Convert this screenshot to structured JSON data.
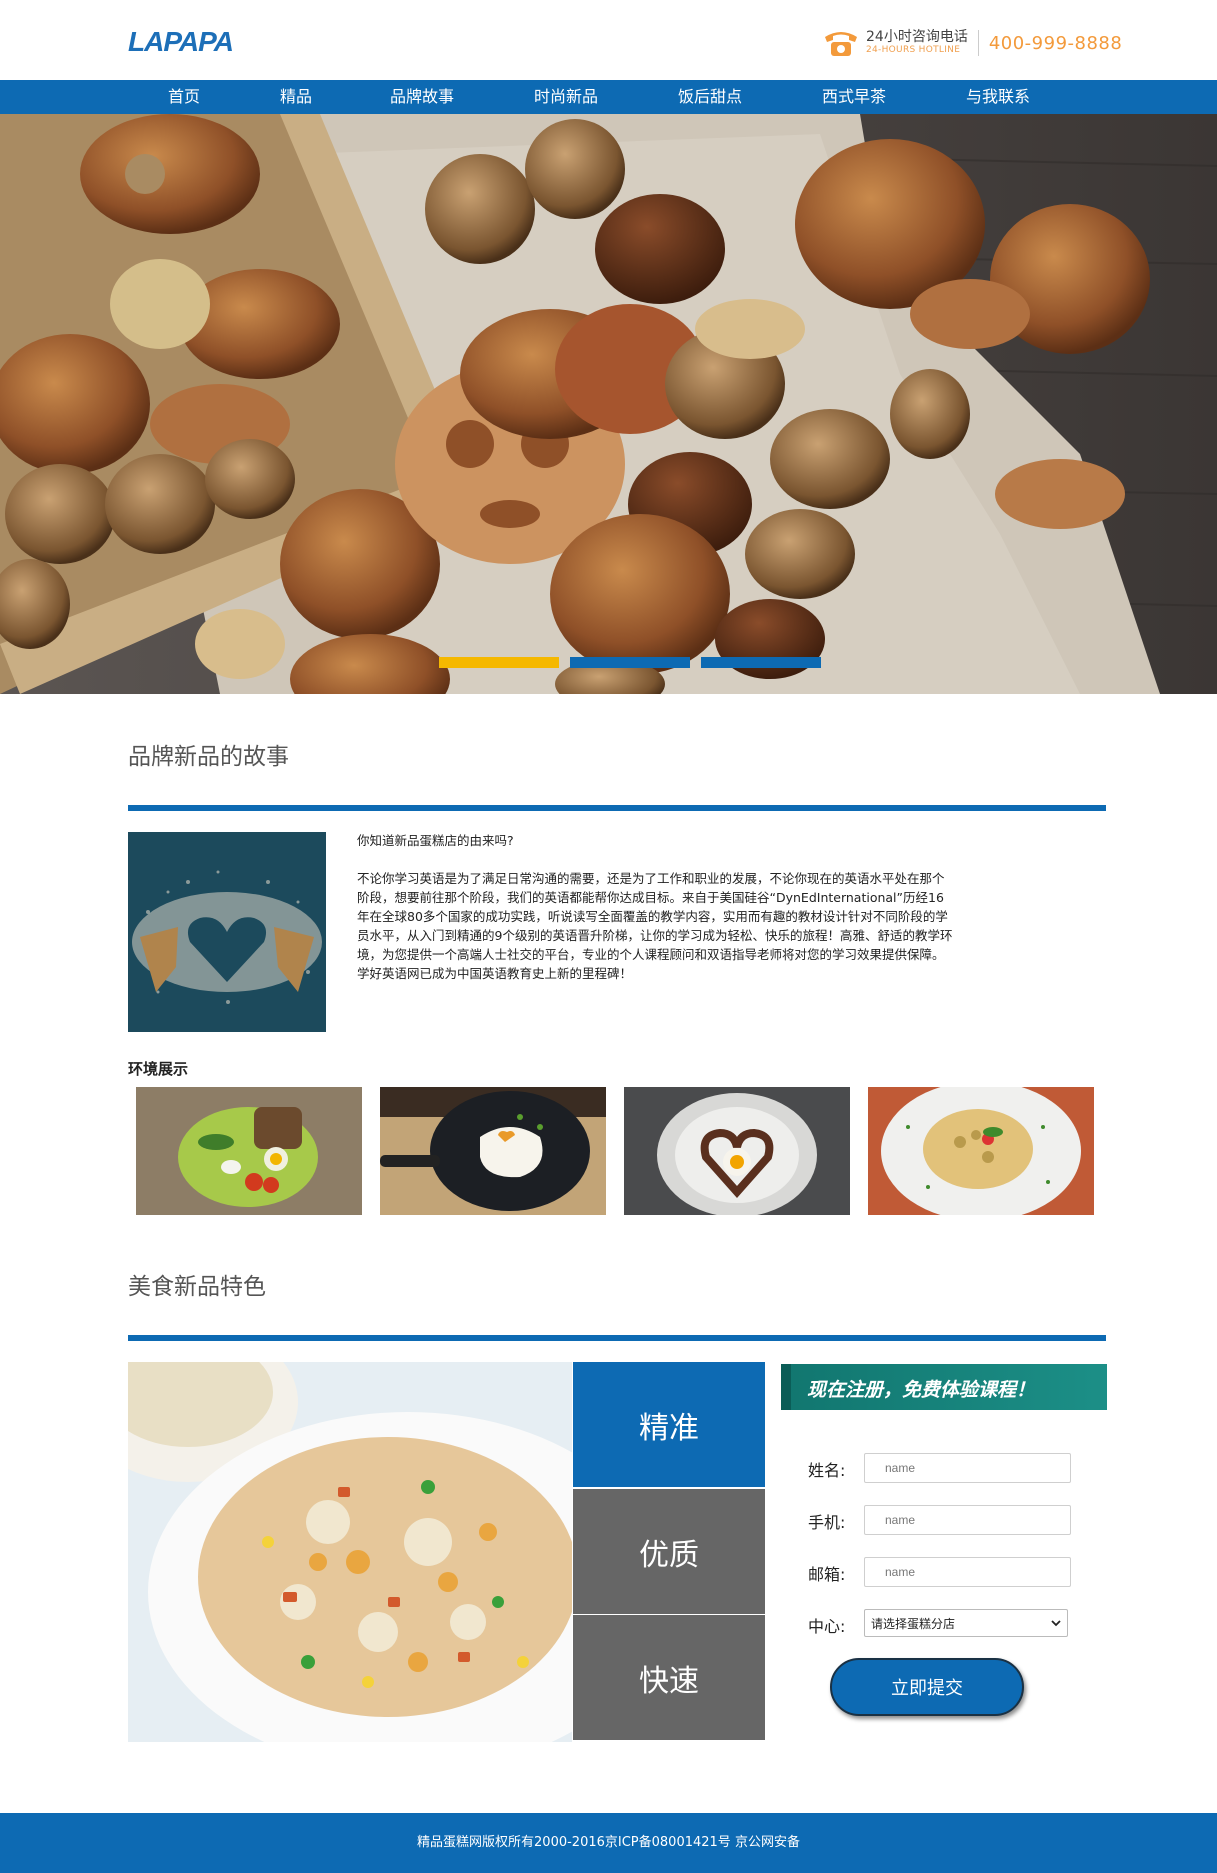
{
  "header": {
    "logo_text": "LAPAPA",
    "hotline_label": "24小时咨询电话",
    "hotline_label_en": "24-HOURS HOTLINE",
    "hotline_number": "400-999-8888",
    "phone_icon": "telephone-icon"
  },
  "nav": {
    "items": [
      "首页",
      "精品",
      "品牌故事",
      "时尚新品",
      "饭后甜点",
      "西式早茶",
      "与我联系"
    ]
  },
  "banner": {
    "slides_count": 3,
    "active_slide": 1,
    "active_color": "#f5b800",
    "inactive_color": "#0d6ab3"
  },
  "story": {
    "title": "品牌新品的故事",
    "question": "你知道新品蛋糕店的由来吗?",
    "body": "不论你学习英语是为了满足日常沟通的需要，还是为了工作和职业的发展，不论你现在的英语水平处在那个阶段，想要前往那个阶段，我们的英语都能帮你达成目标。来自于美国硅谷“DynEdInternational”历经16年在全球80多个国家的成功实践，听说读写全面覆盖的教学内容，实用而有趣的教材设计针对不同阶段的学员水平，从入门到精通的9个级别的英语晋升阶梯，让你的学习成为轻松、快乐的旅程！高雅、舒适的教学环境，为您提供一个高端人士社交的平台，专业的个人课程顾问和双语指导老师将对您的学习效果提供保障。学好英语网已成为中国英语教育史上新的里程碑！"
  },
  "environment": {
    "title": "环境展示"
  },
  "features": {
    "title": "美食新品特色",
    "boxes": [
      {
        "label": "精准",
        "color": "#0d6ab3"
      },
      {
        "label": "优质",
        "color": "#666666"
      },
      {
        "label": "快速",
        "color": "#666666"
      }
    ]
  },
  "signup": {
    "banner_text": "现在注册，免费体验课程！",
    "name_label": "姓名:",
    "phone_label": "手机:",
    "email_label": "邮箱:",
    "center_label": "中心:",
    "name_placeholder": "name",
    "phone_placeholder": "name",
    "email_placeholder": "name",
    "center_selected": "请选择蛋糕分店",
    "submit_label": "立即提交"
  },
  "footer": {
    "copyright": "精品蛋糕网版权所有2000-2016京ICP备08001421号 京公网安备"
  }
}
